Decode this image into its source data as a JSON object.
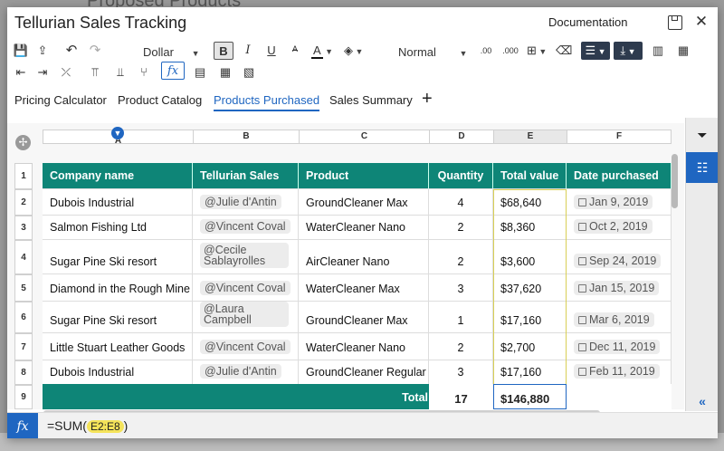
{
  "background_title": "Proposed Products",
  "app": {
    "title": "Tellurian Sales Tracking",
    "documentation_link": "Documentation"
  },
  "toolbar": {
    "number_format": "Dollar",
    "text_style": "Normal",
    "bold_label": "B",
    "italic_label": "I",
    "underline_label": "U",
    "fx_label": "fx"
  },
  "tabs": [
    {
      "label": "Pricing Calculator"
    },
    {
      "label": "Product Catalog"
    },
    {
      "label": "Products Purchased",
      "active": true
    },
    {
      "label": "Sales Summary"
    }
  ],
  "columns": [
    "A",
    "B",
    "C",
    "D",
    "E",
    "F"
  ],
  "row_numbers": [
    "1",
    "2",
    "3",
    "4",
    "5",
    "6",
    "7",
    "8",
    "9"
  ],
  "table": {
    "headers": [
      "Company name",
      "Tellurian Sales",
      "Product",
      "Quantity",
      "Total value",
      "Date purchased"
    ],
    "rows": [
      {
        "company": "Dubois Industrial",
        "sales": "@Julie d'Antin",
        "product": "GroundCleaner Max",
        "qty": "4",
        "total": "$68,640",
        "date": "Jan 9, 2019"
      },
      {
        "company": "Salmon Fishing Ltd",
        "sales": "@Vincent Coval",
        "product": "WaterCleaner Nano",
        "qty": "2",
        "total": "$8,360",
        "date": "Oct 2, 2019"
      },
      {
        "company": "Sugar Pine Ski resort",
        "sales": "@Cecile Sablayrolles",
        "product": "AirCleaner Nano",
        "qty": "2",
        "total": "$3,600",
        "date": "Sep 24, 2019"
      },
      {
        "company": "Diamond in the Rough Mine",
        "sales": "@Vincent Coval",
        "product": "WaterCleaner Max",
        "qty": "3",
        "total": "$37,620",
        "date": "Jan 15, 2019"
      },
      {
        "company": "Sugar Pine Ski resort",
        "sales": "@Laura Campbell",
        "product": "GroundCleaner Max",
        "qty": "1",
        "total": "$17,160",
        "date": "Mar 6, 2019"
      },
      {
        "company": "Little Stuart Leather Goods",
        "sales": "@Vincent Coval",
        "product": "WaterCleaner Nano",
        "qty": "2",
        "total": "$2,700",
        "date": "Dec 11, 2019"
      },
      {
        "company": "Dubois Industrial",
        "sales": "@Julie d'Antin",
        "product": "GroundCleaner Regular",
        "qty": "3",
        "total": "$17,160",
        "date": "Feb 11, 2019"
      }
    ],
    "total_label": "Total",
    "total_qty": "17",
    "total_value": "$146,880"
  },
  "formula_bar": {
    "fx": "fx",
    "prefix": "=SUM(",
    "ref": "E2:E8",
    "suffix": ")"
  },
  "colors": {
    "accent": "#1f66c1",
    "header_teal": "#0e8577"
  }
}
